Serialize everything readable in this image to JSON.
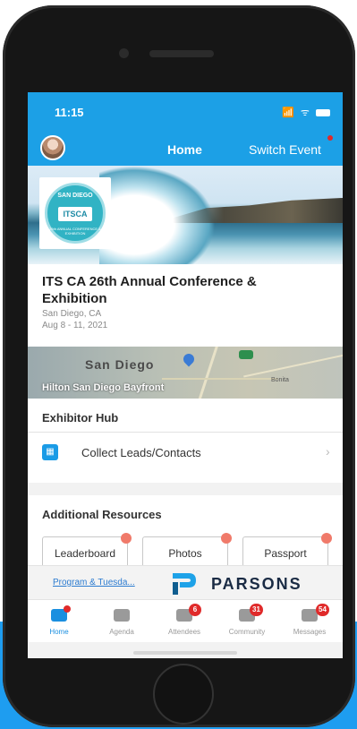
{
  "status_bar": {
    "time": "11:15",
    "icons": "📶 ᯤ"
  },
  "nav": {
    "title": "Home",
    "switch_event": "Switch Event"
  },
  "banner": {
    "logo_top": "SAN DIEGO",
    "logo_main": "ITSCA",
    "logo_sub": "26th ANNUAL CONFERENCE & EXHIBITION"
  },
  "event": {
    "title": "ITS CA 26th Annual Conference & Exhibition",
    "location": "San Diego, CA",
    "dates": "Aug 8 - 11, 2021"
  },
  "map": {
    "city": "San Diego",
    "venue": "Hilton San Diego Bayfront",
    "area": "Bonita"
  },
  "exhibitor_hub": {
    "title": "Exhibitor Hub",
    "item_label": "Collect Leads/Contacts",
    "chevron": "›"
  },
  "resources": {
    "title": "Additional Resources",
    "buttons": [
      "Leaderboard",
      "Photos",
      "Passport"
    ]
  },
  "sponsor": {
    "link_text": "Program & Tuesda...",
    "name": "PARSONS"
  },
  "tabs": [
    {
      "label": "Home",
      "active": true,
      "badge": ""
    },
    {
      "label": "Agenda",
      "active": false,
      "badge": ""
    },
    {
      "label": "Attendees",
      "active": false,
      "badge": "6"
    },
    {
      "label": "Community",
      "active": false,
      "badge": "31"
    },
    {
      "label": "Messages",
      "active": false,
      "badge": "54"
    }
  ],
  "colors": {
    "brand_blue": "#1ca0e6",
    "badge_red": "#e02a2a",
    "parsons_navy": "#1a2b44"
  }
}
